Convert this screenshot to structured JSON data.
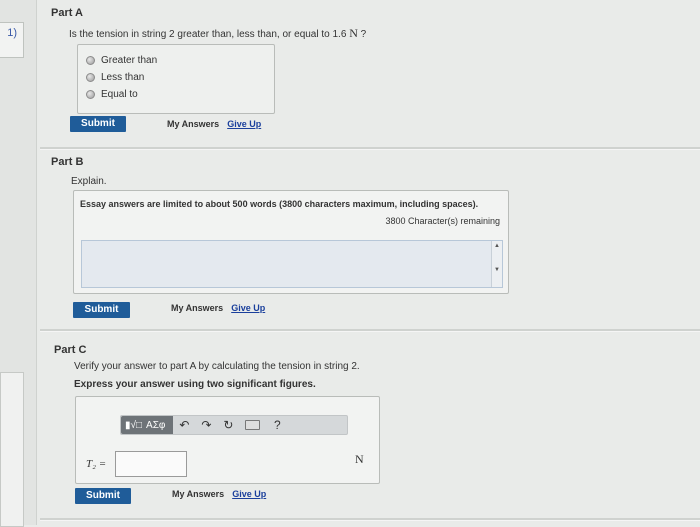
{
  "page_badge": "1)",
  "partA": {
    "title": "Part A",
    "question_prefix": "Is the tension in string 2 greater than, less than, or equal to 1.6",
    "question_unit": "N",
    "question_suffix": "?",
    "options": [
      "Greater than",
      "Less than",
      "Equal to"
    ],
    "submit": "Submit",
    "my_answers": "My Answers",
    "give_up": "Give Up"
  },
  "partB": {
    "title": "Part B",
    "prompt": "Explain.",
    "essay_note": "Essay answers are limited to about 500 words (3800 characters maximum, including spaces).",
    "remaining": "3800 Character(s) remaining",
    "scroll_up": "▲",
    "scroll_down": "▼",
    "submit": "Submit",
    "my_answers": "My Answers",
    "give_up": "Give Up"
  },
  "partC": {
    "title": "Part C",
    "prompt": "Verify your answer to part A by calculating the tension in string 2.",
    "instruction": "Express your answer using two significant figures.",
    "toolbar": {
      "templates": "▮√□",
      "symbols": "ΑΣφ",
      "help": "?"
    },
    "var_label": "T₂ =",
    "unit": "N",
    "submit": "Submit",
    "my_answers": "My Answers",
    "give_up": "Give Up"
  },
  "colors": {
    "submit_bg": "#1f5c99",
    "link": "#1a3f9c"
  }
}
